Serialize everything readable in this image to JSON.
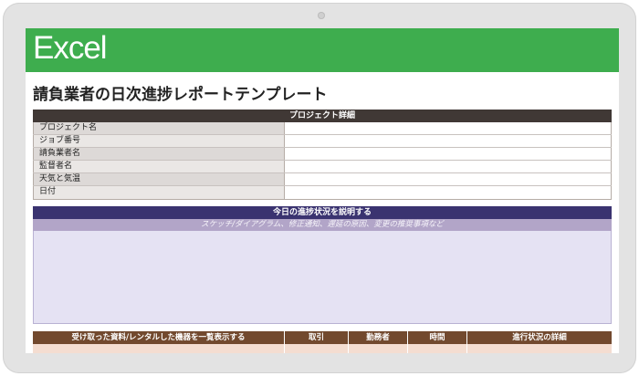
{
  "banner": {
    "title": "Excel"
  },
  "document": {
    "title": "請負業者の日次進捗レポートテンプレート"
  },
  "project_details": {
    "header": "プロジェクト詳細",
    "rows": [
      {
        "label": "プロジェクト名",
        "value": ""
      },
      {
        "label": "ジョブ番号",
        "value": ""
      },
      {
        "label": "請負業者名",
        "value": ""
      },
      {
        "label": "監督者名",
        "value": ""
      },
      {
        "label": "天気と気温",
        "value": ""
      },
      {
        "label": "日付",
        "value": ""
      }
    ]
  },
  "progress": {
    "header": "今日の進捗状況を説明する",
    "subheader": "スケッチ/ダイアグラム、修正通知、遅延の原因、変更の推奨事項など"
  },
  "materials": {
    "columns": [
      "受け取った資料/レンタルした機器を一覧表示する",
      "取引",
      "勤務者",
      "時間",
      "進行状況の詳細"
    ]
  },
  "colors": {
    "banner": "#3ead4e",
    "project_header": "#403835",
    "progress_header": "#3a3370",
    "materials_header": "#72492e"
  }
}
